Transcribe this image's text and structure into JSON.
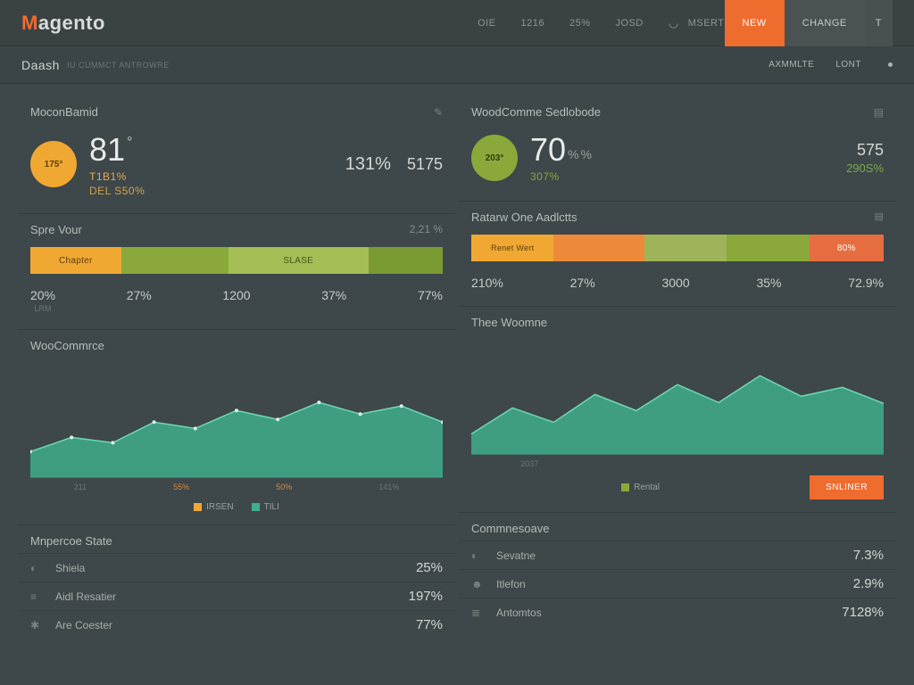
{
  "logo": {
    "m": "M",
    "rest": "agento"
  },
  "topnav": [
    "OIE",
    "1216",
    "25%",
    "JOSD",
    "MSERT"
  ],
  "buttons": {
    "new": "NEW",
    "change": "CHANGE",
    "t": "T"
  },
  "subbar": {
    "title": "Daash",
    "sub": "IU CUMMCT ANTROWRE",
    "r1": "AXMMLTE",
    "r2": "LONT"
  },
  "left": {
    "kpi": {
      "title": "MoconBamid",
      "circle": "175°",
      "big": "81",
      "sub1": "T1B1%",
      "sub2": "DEL S50%",
      "mid": "131%",
      "right": "5175"
    },
    "bar": {
      "title": "Spre Vour",
      "rv": "2,21 %",
      "segs": [
        {
          "c": "o",
          "w": 22,
          "t": "Chapter"
        },
        {
          "c": "g1",
          "w": 26,
          "t": ""
        },
        {
          "c": "g2 g2b",
          "w": 34,
          "t": "SLASE"
        },
        {
          "c": "g3",
          "w": 18,
          "t": ""
        }
      ],
      "nums": [
        {
          "v": "20%",
          "l": "LRM"
        },
        {
          "v": "27%",
          "l": ""
        },
        {
          "v": "1200",
          "l": ""
        },
        {
          "v": "37%",
          "l": ""
        },
        {
          "v": "77%",
          "l": ""
        }
      ]
    },
    "chart": {
      "title": "WooCommrce",
      "x": [
        "211",
        "55%",
        "50%",
        "141%"
      ],
      "leg": [
        {
          "c": "o",
          "t": "IRSEN"
        },
        {
          "c": "t",
          "t": "TILI"
        }
      ]
    },
    "list": {
      "title": "Mnpercoe State",
      "rows": [
        {
          "ic": "◐",
          "t": "Shiela",
          "v": "25%"
        },
        {
          "ic": "≡",
          "t": "Aidl Resatier",
          "v": "197%"
        },
        {
          "ic": "✱",
          "t": "Are Coester",
          "v": "77%"
        }
      ]
    }
  },
  "right": {
    "kpi": {
      "title": "WoodComme Sedlobode",
      "circle": "203°",
      "big": "70",
      "pct": "%",
      "sub1": "307%",
      "right": "575",
      "rg": "290S%"
    },
    "bar": {
      "title": "Ratarw One Aadlctts",
      "segs": [
        {
          "c": "o",
          "w": 20,
          "t": "Renet Wert"
        },
        {
          "c": "o2",
          "w": 22,
          "t": ""
        },
        {
          "c": "lg",
          "w": 20,
          "t": ""
        },
        {
          "c": "g1",
          "w": 20,
          "t": ""
        },
        {
          "c": "or",
          "w": 18,
          "t": "80%"
        }
      ],
      "nums": [
        {
          "v": "210%",
          "l": ""
        },
        {
          "v": "27%",
          "l": ""
        },
        {
          "v": "3000",
          "l": ""
        },
        {
          "v": "35%",
          "l": ""
        },
        {
          "v": "72.9%",
          "l": ""
        }
      ]
    },
    "chart": {
      "title": "Thee Woomne",
      "x": [
        "2037",
        "",
        "",
        ""
      ],
      "leg": [
        {
          "c": "g",
          "t": "Rental"
        }
      ],
      "btn": "SNLINER"
    },
    "list": {
      "title": "Commnesoave",
      "rows": [
        {
          "ic": "◐",
          "t": "Sevatne",
          "v": "7.3%"
        },
        {
          "ic": "☻",
          "t": "Itlefon",
          "v": "2.9%"
        },
        {
          "ic": "≣",
          "t": "Antomtos",
          "v": "7128%"
        }
      ]
    }
  },
  "chart_data": [
    {
      "type": "area",
      "title": "WooCommrce",
      "x": [
        0,
        1,
        2,
        3,
        4,
        5,
        6,
        7,
        8,
        9,
        10
      ],
      "values": [
        22,
        35,
        30,
        48,
        42,
        58,
        50,
        65,
        55,
        62,
        48
      ],
      "ylim": [
        0,
        80
      ]
    },
    {
      "type": "area",
      "title": "Thee Woomne",
      "x": [
        0,
        1,
        2,
        3,
        4,
        5,
        6,
        7,
        8,
        9,
        10
      ],
      "values": [
        18,
        40,
        28,
        52,
        38,
        60,
        45,
        68,
        50,
        58,
        44
      ],
      "ylim": [
        0,
        80
      ]
    }
  ]
}
